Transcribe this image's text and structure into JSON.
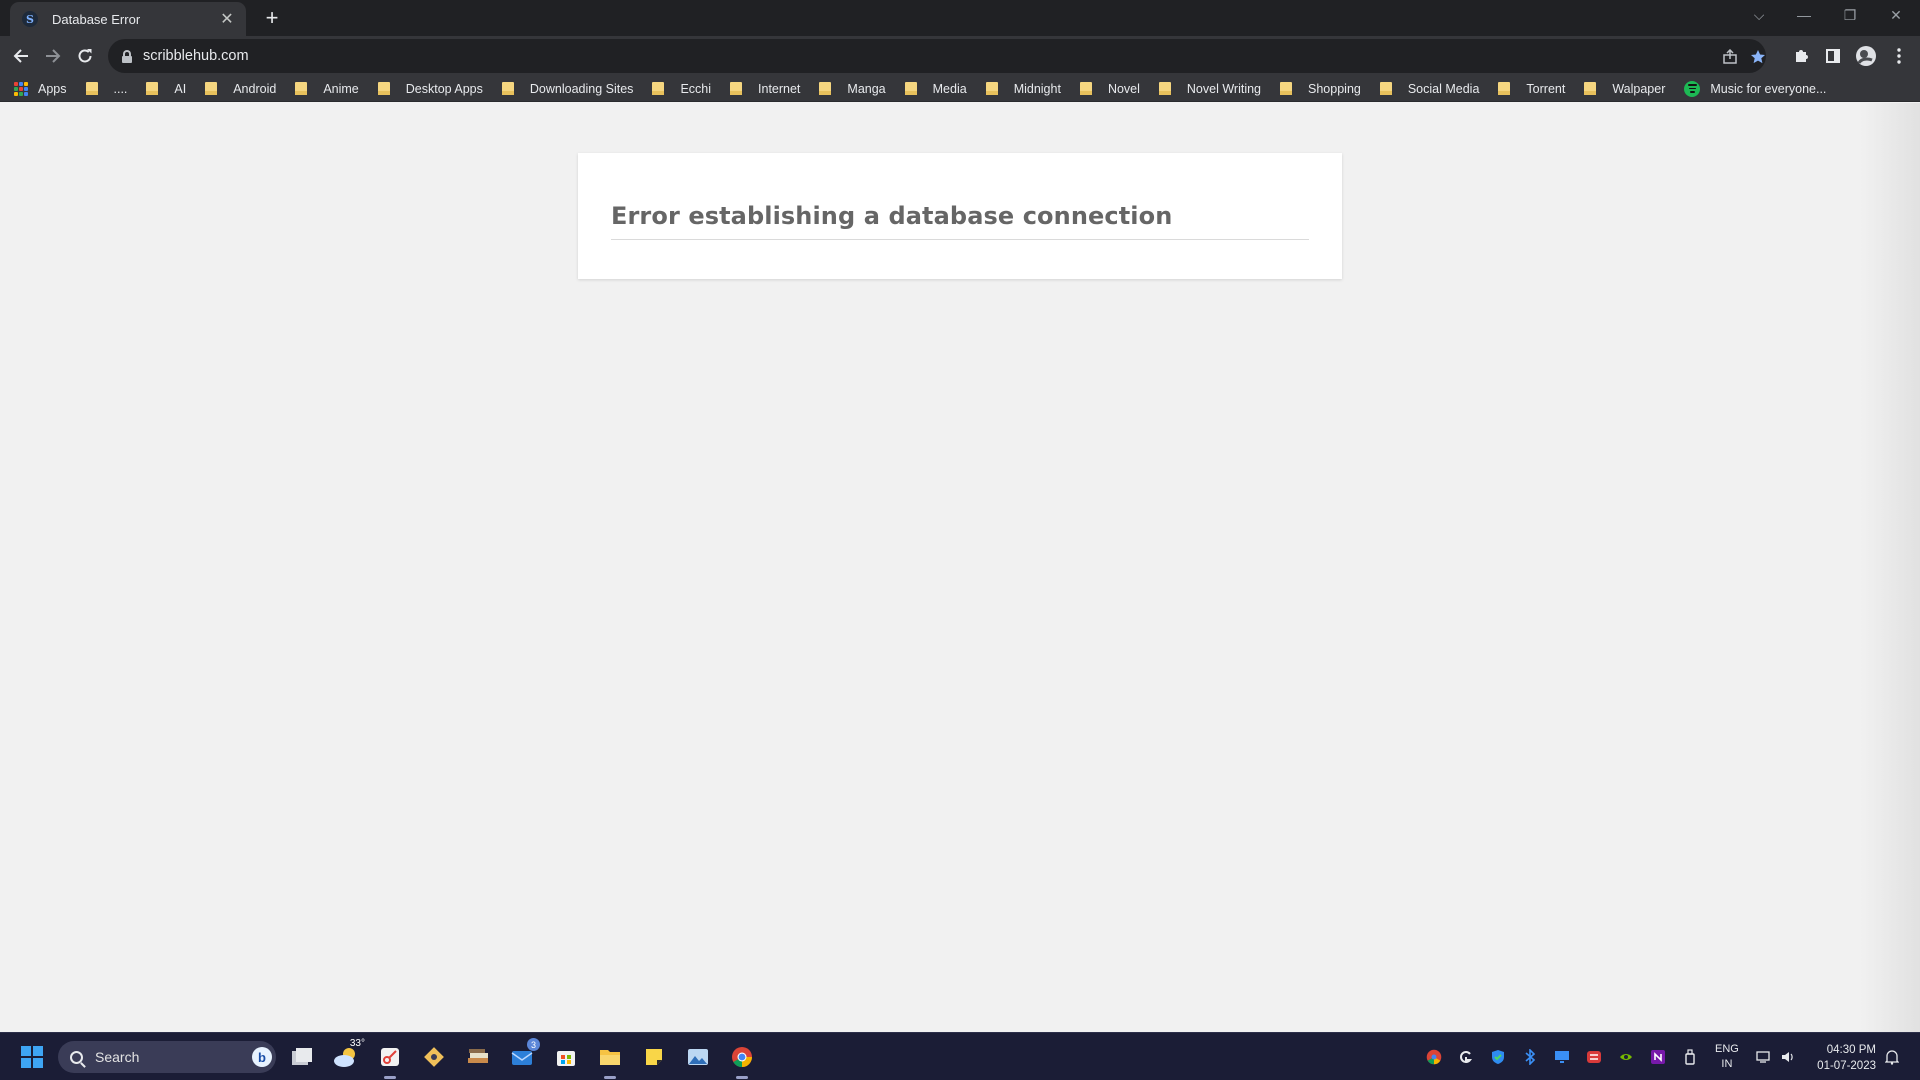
{
  "browser": {
    "tab": {
      "title": "Database Error",
      "favicon": "S"
    },
    "new_tab": "+",
    "window_controls": {
      "dropdown": "⌵",
      "minimize": "—",
      "restore": "❐",
      "close": "✕"
    },
    "url": "scribblehub.com",
    "bookmarks": [
      {
        "label": "Apps",
        "icon": "apps-grid-icon"
      },
      {
        "label": "....",
        "icon": "folder-icon"
      },
      {
        "label": "AI",
        "icon": "folder-icon"
      },
      {
        "label": "Android",
        "icon": "folder-icon"
      },
      {
        "label": "Anime",
        "icon": "folder-icon"
      },
      {
        "label": "Desktop Apps",
        "icon": "folder-icon"
      },
      {
        "label": "Downloading Sites",
        "icon": "folder-icon"
      },
      {
        "label": "Ecchi",
        "icon": "folder-icon"
      },
      {
        "label": "Internet",
        "icon": "folder-icon"
      },
      {
        "label": "Manga",
        "icon": "folder-icon"
      },
      {
        "label": "Media",
        "icon": "folder-icon"
      },
      {
        "label": "Midnight",
        "icon": "folder-icon"
      },
      {
        "label": "Novel",
        "icon": "folder-icon"
      },
      {
        "label": "Novel Writing",
        "icon": "folder-icon"
      },
      {
        "label": "Shopping",
        "icon": "folder-icon"
      },
      {
        "label": "Social Media",
        "icon": "folder-icon"
      },
      {
        "label": "Torrent",
        "icon": "folder-icon"
      },
      {
        "label": "Walpaper",
        "icon": "folder-icon"
      },
      {
        "label": "Music for everyone...",
        "icon": "spotify-icon"
      }
    ]
  },
  "page": {
    "error_message": "Error establishing a database connection"
  },
  "taskbar": {
    "search_placeholder": "Search",
    "bing_letter": "b",
    "weather_temp": "33°",
    "mail_badge": "3",
    "language": {
      "line1": "ENG",
      "line2": "IN"
    },
    "time": "04:30 PM",
    "date": "01-07-2023"
  },
  "colors": {
    "chrome_dark": "#202124",
    "chrome_toolbar": "#35363a",
    "page_bg": "#f1f1f1",
    "card_bg": "#ffffff",
    "error_text": "#666666",
    "bookmark_star": "#8ab4f8",
    "taskbar_bg": "#1b1d36"
  }
}
